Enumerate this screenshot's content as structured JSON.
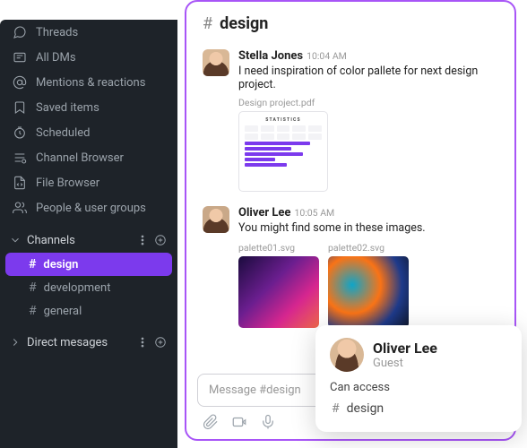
{
  "sidebar": {
    "nav": [
      {
        "label": "Threads"
      },
      {
        "label": "All DMs"
      },
      {
        "label": "Mentions & reactions"
      },
      {
        "label": "Saved items"
      },
      {
        "label": "Scheduled"
      },
      {
        "label": "Channel Browser"
      },
      {
        "label": "File Browser"
      },
      {
        "label": "People & user groups"
      }
    ],
    "sections": {
      "channels": {
        "label": "Channels",
        "items": [
          {
            "name": "design",
            "active": true
          },
          {
            "name": "development",
            "active": false
          },
          {
            "name": "general",
            "active": false
          }
        ]
      },
      "dms": {
        "label": "Direct mesages"
      }
    }
  },
  "chat": {
    "title": "design",
    "messages": [
      {
        "author": "Stella Jones",
        "time": "10:04 AM",
        "text": "I need inspiration of color pallete for next design project.",
        "attachments": [
          {
            "label": "Design project.pdf",
            "type": "doc",
            "doc_title": "STATISTICS"
          }
        ]
      },
      {
        "author": "Oliver Lee",
        "time": "10:05 AM",
        "text": "You might find some in these images.",
        "attachments": [
          {
            "label": "palette01.svg",
            "type": "img"
          },
          {
            "label": "palette02.svg",
            "type": "img"
          }
        ]
      }
    ],
    "composer_placeholder": "Message #design"
  },
  "popover": {
    "name": "Oliver Lee",
    "role": "Guest",
    "access_label": "Can access",
    "access_channel": "design"
  }
}
